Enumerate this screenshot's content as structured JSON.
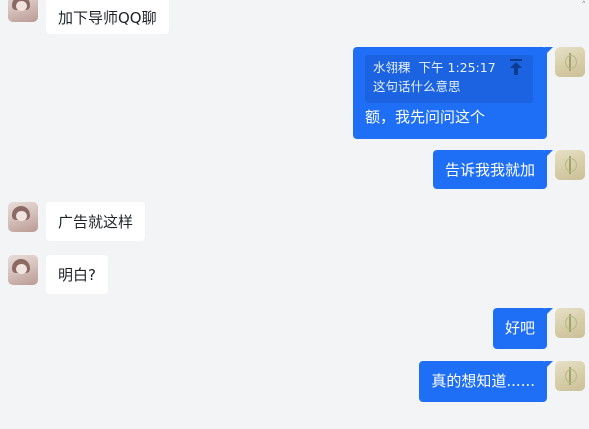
{
  "chat": {
    "messages": [
      {
        "side": "left",
        "text": "加下导师QQ聊"
      },
      {
        "side": "right",
        "reply": {
          "sender": "水翎稞",
          "time": "下午 1:25:17",
          "quoted": "这句话什么意思"
        },
        "text": "额，我先问问这个"
      },
      {
        "side": "right",
        "text": "告诉我我就加"
      },
      {
        "side": "left",
        "text": "广告就这样"
      },
      {
        "side": "left",
        "text": "明白?"
      },
      {
        "side": "right",
        "text": "好吧"
      },
      {
        "side": "right",
        "text": "真的想知道......"
      }
    ]
  },
  "icons": {
    "left_avatar": "avatar-girl-icon",
    "right_avatar": "avatar-wheat-icon",
    "quote_jump": "arrow-up-to-top-icon"
  },
  "colors": {
    "background": "#f3f4f6",
    "outgoing_bubble": "#1e6ff5",
    "incoming_bubble": "#ffffff"
  }
}
